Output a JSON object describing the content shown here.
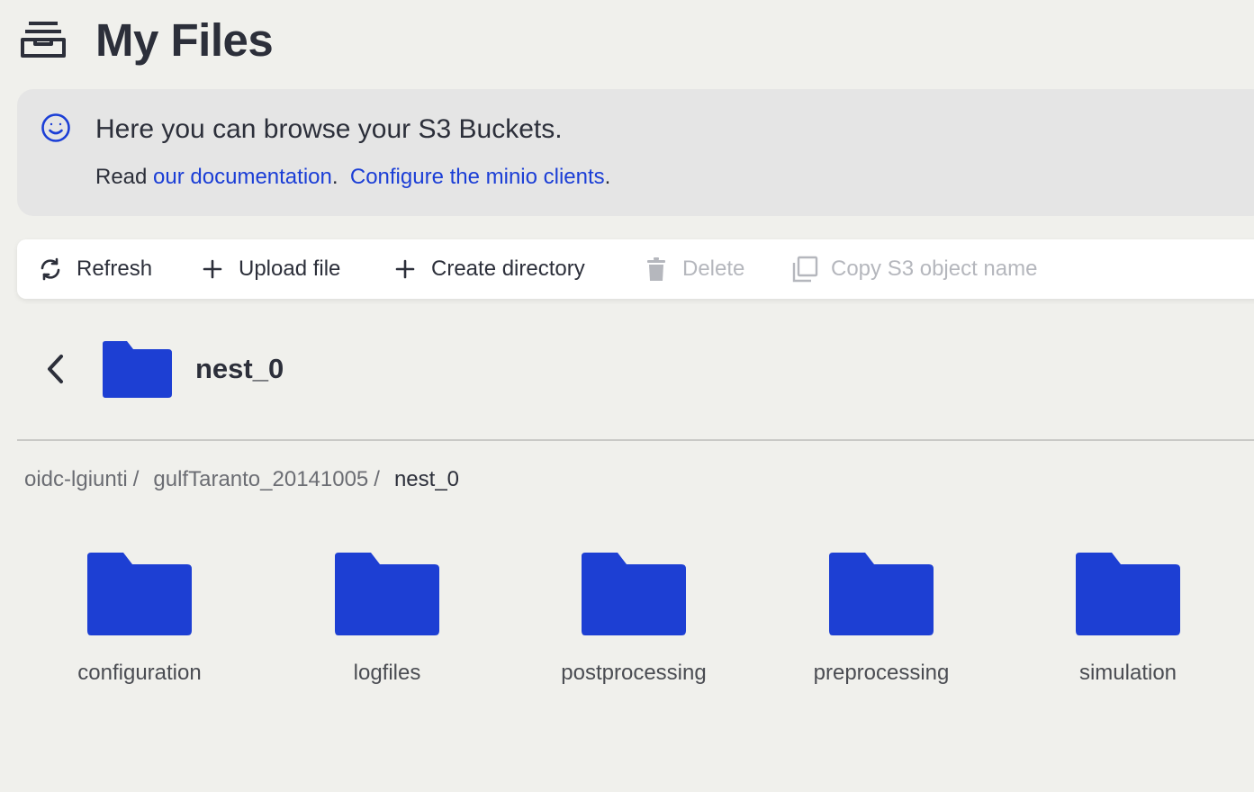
{
  "header": {
    "title": "My Files",
    "icon": "files-tray-icon"
  },
  "banner": {
    "icon": "smiley-icon",
    "headline": "Here you can browse your S3 Buckets.",
    "read_prefix": "Read ",
    "doc_link": "our documentation",
    "period1": ".",
    "config_link": "Configure the minio clients",
    "period2": "."
  },
  "toolbar": {
    "refresh": "Refresh",
    "upload": "Upload file",
    "create_dir": "Create directory",
    "delete": "Delete",
    "copy_name": "Copy S3 object name"
  },
  "current_dir": {
    "name": "nest_0"
  },
  "breadcrumb": {
    "items": [
      "oidc-lgiunti",
      "gulfTaranto_20141005"
    ],
    "separator": "/",
    "current": "nest_0"
  },
  "folders": [
    {
      "name": "configuration"
    },
    {
      "name": "logfiles"
    },
    {
      "name": "postprocessing"
    },
    {
      "name": "preprocessing"
    },
    {
      "name": "simulation"
    }
  ],
  "colors": {
    "accent": "#1b3ed6",
    "folder": "#1d3fd3",
    "text": "#2c2f3a",
    "muted": "#b5b7bd"
  }
}
